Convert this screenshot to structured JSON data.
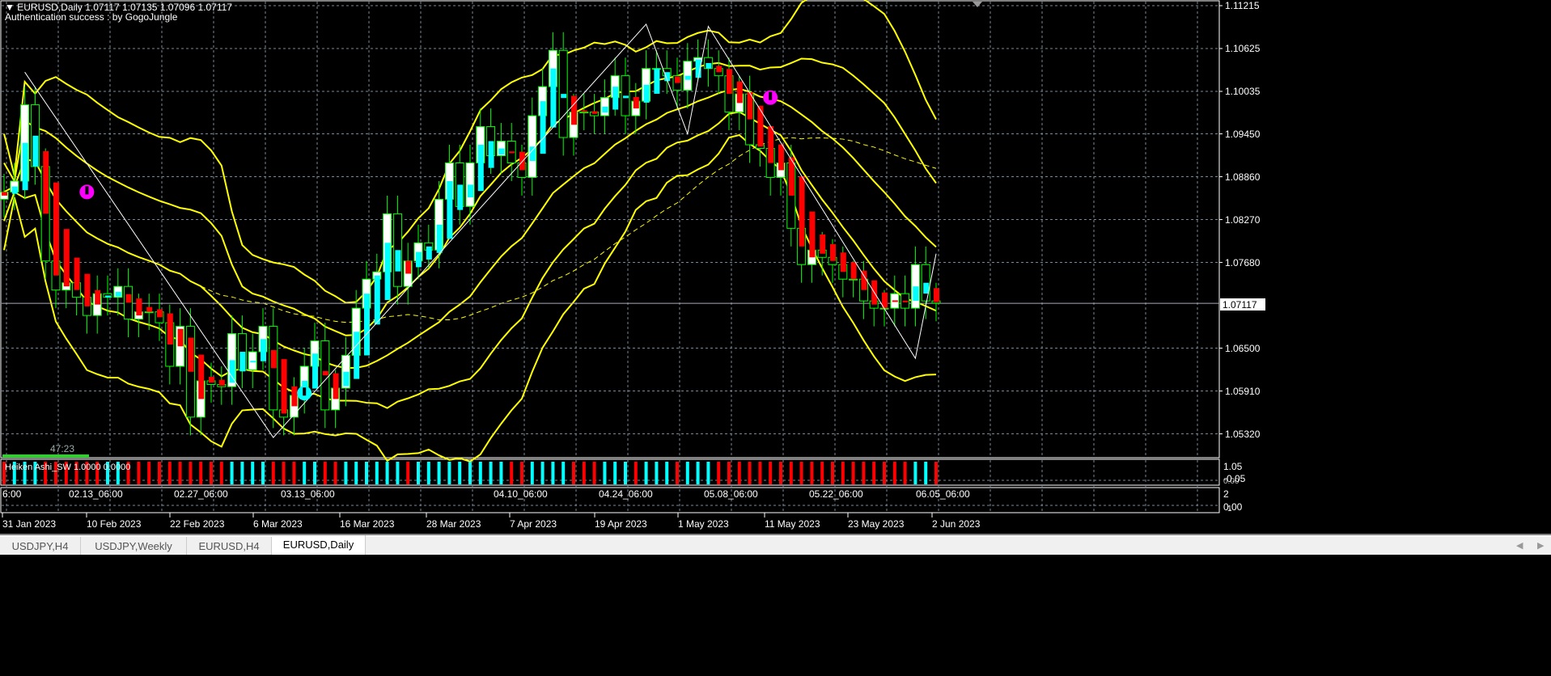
{
  "header": {
    "symbol_line": "EURUSD,Daily  1.07117 1.07135 1.07096 1.07117",
    "auth": "Authentication success : by GogoJungle"
  },
  "price_axis": [
    "1.11215",
    "1.10625",
    "1.10035",
    "1.09450",
    "1.08860",
    "1.08270",
    "1.07680",
    "1.06500",
    "1.05910",
    "1.05320"
  ],
  "current_price": "1.07117",
  "timer": "47:23",
  "timer_progress": 0.2,
  "indicator": {
    "name": "Heiken Ashi_SW 1.0000 0.0000",
    "scale_top": "1.05",
    "scale_bottom": "-0.05",
    "scale_zero": "0.00"
  },
  "sub2": {
    "labels": [
      "6:00",
      "02.13_06:00",
      "02.27_06:00",
      "03.13_06:00",
      "04.10_06:00",
      "04.24_06:00",
      "05.08_06:00",
      "05.22_06:00",
      "06.05_06:00"
    ],
    "scale_top": "2",
    "scale_mid": "0.00",
    "scale_low": "1"
  },
  "time_axis": [
    "31 Jan 2023",
    "10 Feb 2023",
    "22 Feb 2023",
    "6 Mar 2023",
    "16 Mar 2023",
    "28 Mar 2023",
    "7 Apr 2023",
    "19 Apr 2023",
    "1 May 2023",
    "11 May 2023",
    "23 May 2023",
    "2 Jun 2023"
  ],
  "tabs": [
    "USDJPY,H4",
    "USDJPY,Weekly",
    "EURUSD,H4",
    "EURUSD,Daily"
  ],
  "active_tab": 3,
  "colors": {
    "bull": "#00ffff",
    "bear": "#ff0000",
    "band": "#ffff00",
    "candle_outline": "#00ff00",
    "grid": "#778899"
  },
  "chart_data": {
    "type": "candlestick",
    "closes": [
      1.0865,
      1.088,
      1.0985,
      1.09,
      1.077,
      1.073,
      1.074,
      1.072,
      1.0695,
      1.0725,
      1.072,
      1.0735,
      1.069,
      1.07,
      1.07,
      1.0685,
      1.0625,
      1.068,
      1.0555,
      1.0605,
      1.06,
      1.0597,
      1.067,
      1.062,
      1.0645,
      1.068,
      1.0565,
      1.0555,
      1.0585,
      1.0625,
      1.066,
      1.0565,
      1.0595,
      1.064,
      1.0705,
      1.0745,
      1.0755,
      1.0835,
      1.0735,
      1.077,
      1.0795,
      1.0785,
      1.0855,
      1.0905,
      1.0845,
      1.0905,
      1.0955,
      1.0915,
      1.0935,
      1.0905,
      1.0885,
      1.097,
      1.101,
      1.106,
      1.094,
      1.0975,
      1.0975,
      1.097,
      1.0995,
      1.1025,
      1.097,
      1.099,
      1.1035,
      1.1035,
      1.1025,
      1.1005,
      1.1045,
      1.105,
      1.1035,
      1.1025,
      1.0975,
      1.1,
      1.093,
      1.0925,
      1.0885,
      1.0905,
      1.0815,
      1.0765,
      1.0785,
      1.0775,
      1.0765,
      1.0745,
      1.0745,
      1.0715,
      1.0705,
      1.0705,
      1.0725,
      1.0705,
      1.0765,
      1.0715,
      1.0712
    ],
    "zigzag": [
      [
        2,
        1.103
      ],
      [
        26,
        1.0527
      ],
      [
        62,
        1.1096
      ],
      [
        66,
        1.0945
      ],
      [
        68,
        1.1093
      ],
      [
        88,
        1.0636
      ],
      [
        90,
        1.078
      ]
    ],
    "signals": [
      {
        "bar": 8,
        "price": 1.0865,
        "color": "#ff00ff"
      },
      {
        "bar": 29,
        "price": 1.0588,
        "color": "#00ffff"
      },
      {
        "bar": 74,
        "price": 1.0995,
        "color": "#ff00ff"
      }
    ]
  }
}
